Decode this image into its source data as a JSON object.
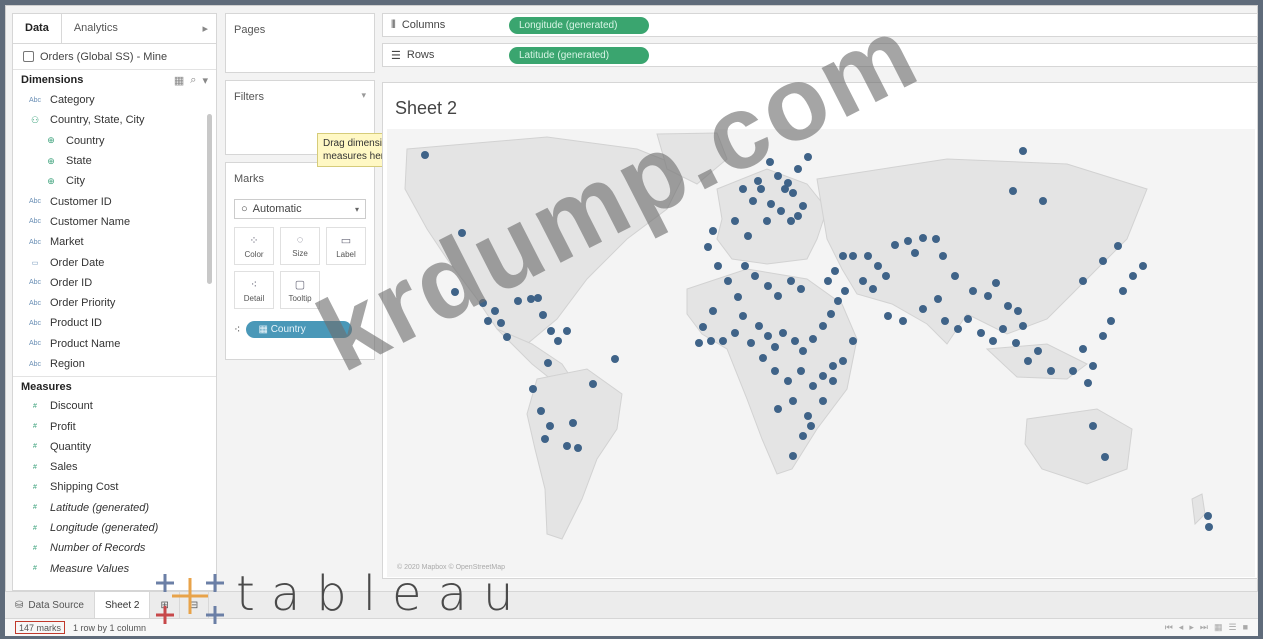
{
  "data_pane": {
    "tabs": [
      "Data",
      "Analytics"
    ],
    "datasource": "Orders (Global SS) - Mine",
    "dimensions_label": "Dimensions",
    "dimensions": [
      {
        "label": "Category",
        "icon": "abc-icon",
        "indent": false
      },
      {
        "label": "Country, State, City",
        "icon": "hierarchy-icon",
        "indent": false
      },
      {
        "label": "Country",
        "icon": "globe-icon",
        "indent": true
      },
      {
        "label": "State",
        "icon": "globe-icon",
        "indent": true
      },
      {
        "label": "City",
        "icon": "globe-icon",
        "indent": true
      },
      {
        "label": "Customer ID",
        "icon": "abc-icon",
        "indent": false
      },
      {
        "label": "Customer Name",
        "icon": "abc-icon",
        "indent": false
      },
      {
        "label": "Market",
        "icon": "abc-icon",
        "indent": false
      },
      {
        "label": "Order Date",
        "icon": "calendar-icon",
        "indent": false
      },
      {
        "label": "Order ID",
        "icon": "abc-icon",
        "indent": false
      },
      {
        "label": "Order Priority",
        "icon": "abc-icon",
        "indent": false
      },
      {
        "label": "Product ID",
        "icon": "abc-icon",
        "indent": false
      },
      {
        "label": "Product Name",
        "icon": "abc-icon",
        "indent": false
      },
      {
        "label": "Region",
        "icon": "abc-icon",
        "indent": false
      }
    ],
    "measures_label": "Measures",
    "measures": [
      {
        "label": "Discount",
        "italic": false
      },
      {
        "label": "Profit",
        "italic": false
      },
      {
        "label": "Quantity",
        "italic": false
      },
      {
        "label": "Sales",
        "italic": false
      },
      {
        "label": "Shipping Cost",
        "italic": false
      },
      {
        "label": "Latitude (generated)",
        "italic": true
      },
      {
        "label": "Longitude (generated)",
        "italic": true
      },
      {
        "label": "Number of Records",
        "italic": true
      },
      {
        "label": "Measure Values",
        "italic": true
      }
    ]
  },
  "pages_label": "Pages",
  "filters_label": "Filters",
  "marks": {
    "label": "Marks",
    "type": "Automatic",
    "buttons": [
      "Color",
      "Size",
      "Label",
      "Detail",
      "Tooltip"
    ],
    "detail_pill": "Country"
  },
  "drop_hint": "Drag dimensions or measures here.",
  "shelves": {
    "columns_label": "Columns",
    "columns_pill": "Longitude (generated)",
    "rows_label": "Rows",
    "rows_pill": "Latitude (generated)"
  },
  "view": {
    "title": "Sheet 2",
    "attribution": "© 2020 Mapbox © OpenStreetMap",
    "mark_color": "#3f6388"
  },
  "tabs": {
    "data_source": "Data Source",
    "sheet": "Sheet 2"
  },
  "status": {
    "marks": "147 marks",
    "rows_cols": "1 row by 1 column"
  },
  "watermark": "krdump.com",
  "logo": "tableau"
}
